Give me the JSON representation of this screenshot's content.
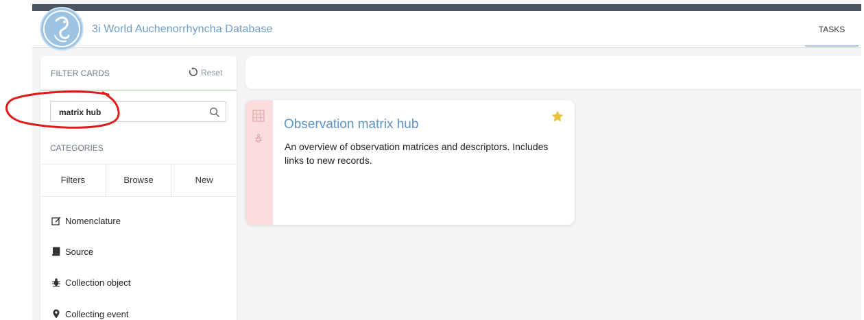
{
  "header": {
    "app_title": "3i World Auchenorrhyncha Database",
    "tasks_label": "TASKS"
  },
  "sidebar": {
    "filter_title": "FILTER CARDS",
    "reset_label": "Reset",
    "search": {
      "value": "matrix hub",
      "placeholder": ""
    },
    "categories_title": "CATEGORIES",
    "tabs": [
      {
        "label": "Filters"
      },
      {
        "label": "Browse"
      },
      {
        "label": "New"
      }
    ],
    "items": [
      {
        "label": "Nomenclature",
        "icon": "edit-icon"
      },
      {
        "label": "Source",
        "icon": "book-icon"
      },
      {
        "label": "Collection object",
        "icon": "bug-icon"
      },
      {
        "label": "Collecting event",
        "icon": "map-marker-icon"
      }
    ]
  },
  "card": {
    "title": "Observation matrix hub",
    "description": "An overview of observation matrices and descriptors. Includes links to new records.",
    "favorite": true,
    "side_color": "#fbdcdc",
    "star_color": "#e8c23a"
  },
  "colors": {
    "accent": "#6b9cc7",
    "annotation": "#e0191b"
  }
}
